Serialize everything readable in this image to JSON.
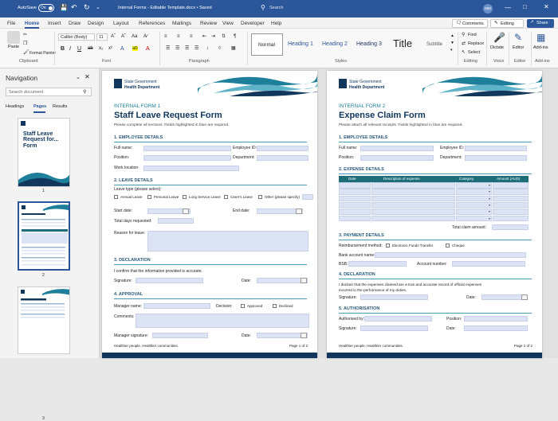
{
  "titlebar": {
    "autosave_label": "AutoSave",
    "autosave_toggle": "On",
    "doc_title": "Internal Forms - Editable Template.docx • Saved",
    "search_placeholder": "Search",
    "user_initials": "MM"
  },
  "menu": {
    "tabs": [
      "File",
      "Home",
      "Insert",
      "Draw",
      "Design",
      "Layout",
      "References",
      "Mailings",
      "Review",
      "View",
      "Developer",
      "Help"
    ],
    "active_tab": "Home",
    "comments_label": "Comments",
    "editing_label": "Editing",
    "share_label": "Share"
  },
  "ribbon": {
    "paste_label": "Paste",
    "format_painter_label": "Format Painter",
    "font_name": "Calibri (Body)",
    "font_size": "11",
    "styles": [
      "Normal",
      "Heading 1",
      "Heading 2",
      "Heading 3",
      "Title",
      "Subtitle"
    ],
    "find_label": "Find",
    "replace_label": "Replace",
    "select_label": "Select",
    "dictate_label": "Dictate",
    "editor_label": "Editor",
    "addins_label": "Add-ins",
    "groups": [
      "Clipboard",
      "Font",
      "Paragraph",
      "Styles",
      "Editing",
      "Voice",
      "Editor",
      "Add-ins"
    ]
  },
  "nav": {
    "title": "Navigation",
    "search_placeholder": "Search document",
    "tabs": [
      "Headings",
      "Pages",
      "Results"
    ],
    "active_tab": "Pages",
    "thumb1_text": "Staff Leave Request for... Form",
    "page_numbers": [
      "1",
      "2",
      "3"
    ]
  },
  "page1": {
    "org_line1": "State Government",
    "org_line2": "Health Department",
    "form_number": "INTERNAL FORM 1",
    "form_title": "Staff Leave Request Form",
    "instructions": "Please complete all sections. Fields highlighted in blue are required.",
    "sec1": "1.   EMPLOYEE DETAILS",
    "full_name": "Full name:",
    "employee_id": "Employee ID:",
    "position": "Position:",
    "department": "Department:",
    "work_location": "Work location:",
    "sec2": "2.   LEAVE DETAILS",
    "leave_type": "Leave type (please select):",
    "leave_options": [
      "Annual Leave",
      "Personal Leave",
      "Long Service Leave",
      "Carer's Leave",
      "Other (please specify)"
    ],
    "start_date": "Start date:",
    "end_date": "End date:",
    "total_days": "Total days requested:",
    "reason": "Reason for leave:",
    "sec3": "3.   DECLARATION",
    "declaration_text": "I confirm that the information provided is accurate.",
    "signature": "Signature:",
    "date": "Date:",
    "sec4": "4.   APPROVAL",
    "manager_name": "Manager name:",
    "decision": "Decision:",
    "approved": "Approved",
    "declined": "Declined",
    "comments": "Comments:",
    "manager_signature": "Manager signature:",
    "date2": "Date:",
    "footer_left": "Healthier people. Healthier communities.",
    "footer_right": "Page 1 of 2"
  },
  "page2": {
    "org_line1": "State Government",
    "org_line2": "Health Department",
    "form_number": "INTERNAL FORM 2",
    "form_title": "Expense Claim Form",
    "instructions": "Please attach all relevant receipts. Fields highlighted in blue are required.",
    "sec1": "1.   EMPLOYEE DETAILS",
    "full_name": "Full name:",
    "employee_id": "Employee ID:",
    "position": "Position:",
    "department": "Department:",
    "sec2": "2.   EXPENSE DETAILS",
    "table_headers": [
      "Date",
      "Description of expense",
      "Category",
      "Amount (AUD)"
    ],
    "total_claim": "Total claim amount:",
    "sec3": "3.   PAYMENT DETAILS",
    "reimbursement_method": "Reimbursement method:",
    "eft": "Electronic Funds Transfer",
    "cheque": "Cheque",
    "bank_account_name": "Bank account name:",
    "bsb": "BSB:",
    "account_number": "Account number:",
    "sec4": "4.   DECLARATION",
    "declaration_line1": "I declare that the expenses claimed are a true and accurate record of official expenses",
    "declaration_line2": "incurred in the performance of my duties.",
    "signature": "Signature:",
    "date": "Date:",
    "sec5": "5.   AUTHORISATION",
    "authorised_by": "Authorised by:",
    "position2": "Position:",
    "signature2": "Signature:",
    "date2": "Date:",
    "footer_left": "Healthier people. Healthier communities.",
    "footer_right": "Page 2 of 2"
  },
  "colors": {
    "word_blue": "#2b579a",
    "field_blue": "#dbe3f4",
    "teal": "#1e7f9a",
    "navy": "#12375c"
  }
}
